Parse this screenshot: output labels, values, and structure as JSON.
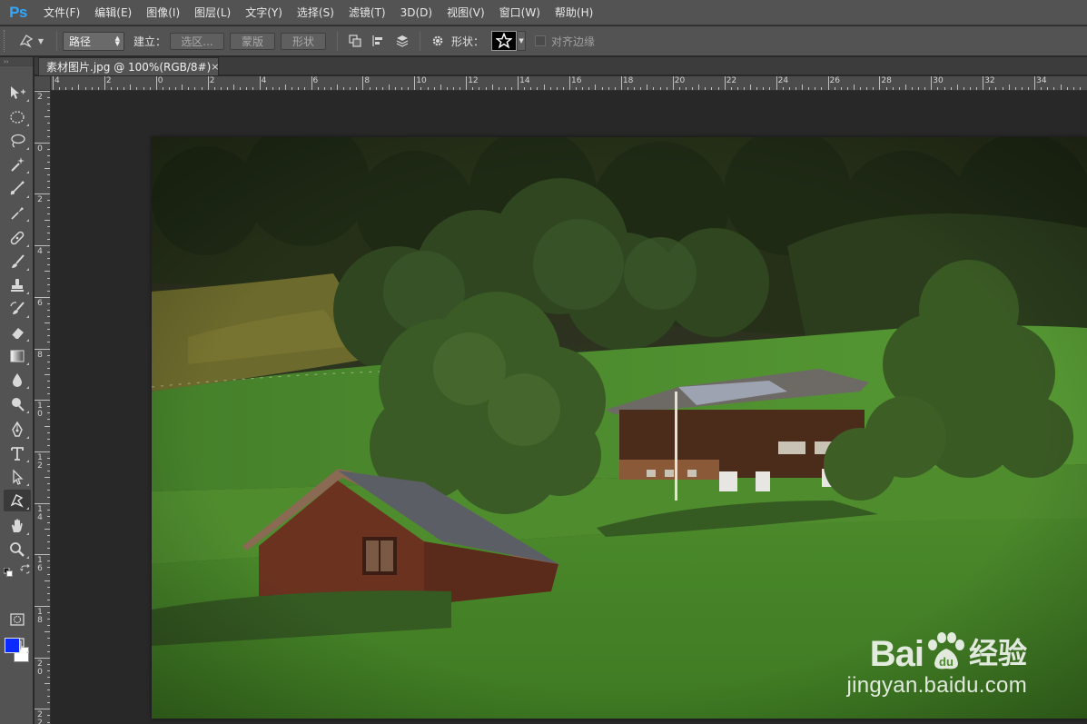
{
  "app": {
    "logo": "Ps",
    "menu": [
      "文件(F)",
      "编辑(E)",
      "图像(I)",
      "图层(L)",
      "文字(Y)",
      "选择(S)",
      "滤镜(T)",
      "3D(D)",
      "视图(V)",
      "窗口(W)",
      "帮助(H)"
    ]
  },
  "options": {
    "tool_icon": "freeform-pen-icon",
    "mode_value": "路径",
    "make_label": "建立：",
    "selection_button": "选区...",
    "mask_button": "蒙版",
    "shape_button": "形状",
    "shape_label": "形状：",
    "shape_value": "star",
    "align_edges_label": "对齐边缘",
    "align_edges_checked": false
  },
  "document": {
    "tab_title": "素材图片.jpg @ 100%(RGB/8#)",
    "close_glyph": "×"
  },
  "rulers": {
    "horizontal_labels": [
      "4",
      "2",
      "0",
      "2",
      "4",
      "6",
      "8",
      "10",
      "12",
      "14",
      "16",
      "18",
      "20",
      "22",
      "24",
      "26",
      "28",
      "30",
      "32",
      "34"
    ],
    "vertical_labels": [
      "2",
      "0",
      "2",
      "4",
      "6",
      "8",
      "10",
      "12",
      "14",
      "16",
      "18",
      "20",
      "22"
    ]
  },
  "tools": [
    "move-tool-icon",
    "elliptical-marquee-icon",
    "lasso-icon",
    "magic-wand-icon",
    "crop-icon",
    "eyedropper-icon",
    "spot-healing-icon",
    "brush-icon",
    "clone-stamp-icon",
    "history-brush-icon",
    "eraser-icon",
    "gradient-icon",
    "blur-icon",
    "dodge-icon",
    "pen-icon",
    "type-icon",
    "path-selection-icon",
    "custom-shape-icon",
    "hand-icon",
    "zoom-icon",
    "quick-mask-icon",
    "screen-mode-icon"
  ],
  "colors": {
    "foreground": "#0a2aff",
    "background": "#ffffff",
    "ui_panel": "#535353",
    "workspace": "#282828"
  },
  "watermark": {
    "brand": "Bai",
    "brand_suffix": "du",
    "cn": "经验",
    "url": "jingyan.baidu.com"
  }
}
